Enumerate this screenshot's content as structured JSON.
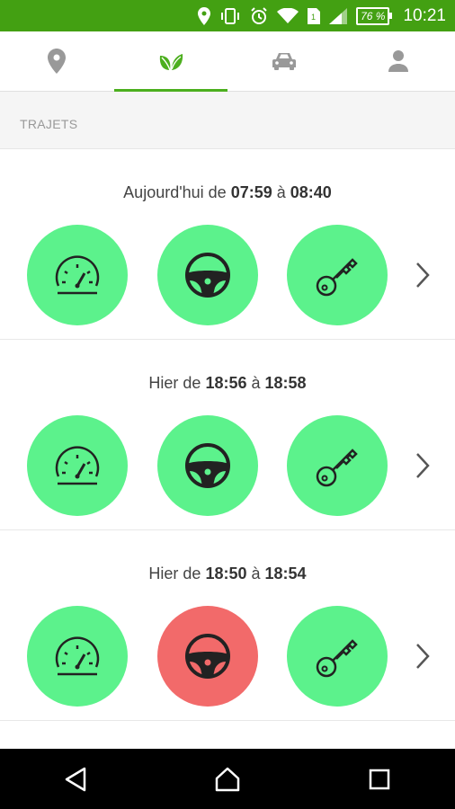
{
  "status_bar": {
    "time": "10:21",
    "battery": "76 %",
    "icons": [
      "location-icon",
      "vibrate-icon",
      "alarm-icon",
      "wifi-icon",
      "sim-icon",
      "signal-icon",
      "battery-icon"
    ]
  },
  "tabs": [
    {
      "icon": "map-pin-icon",
      "active": false
    },
    {
      "icon": "leaf-icon",
      "active": true
    },
    {
      "icon": "car-icon",
      "active": false
    },
    {
      "icon": "person-icon",
      "active": false
    }
  ],
  "section": {
    "title": "TRAJETS"
  },
  "trips": [
    {
      "prefix": "Aujourd'hui de ",
      "start": "07:59",
      "sep": " à ",
      "end": "08:40",
      "indicators": [
        "ok",
        "ok",
        "ok"
      ]
    },
    {
      "prefix": "Hier de ",
      "start": "18:56",
      "sep": " à ",
      "end": "18:58",
      "indicators": [
        "ok",
        "ok",
        "ok"
      ]
    },
    {
      "prefix": "Hier de ",
      "start": "18:50",
      "sep": " à ",
      "end": "18:54",
      "indicators": [
        "ok",
        "alert",
        "ok"
      ]
    }
  ],
  "indicator_icons": [
    "speedometer-icon",
    "steering-wheel-icon",
    "key-icon"
  ],
  "colors": {
    "ok": "#5cf28c",
    "alert": "#f26a6a",
    "accent": "#43a012"
  }
}
